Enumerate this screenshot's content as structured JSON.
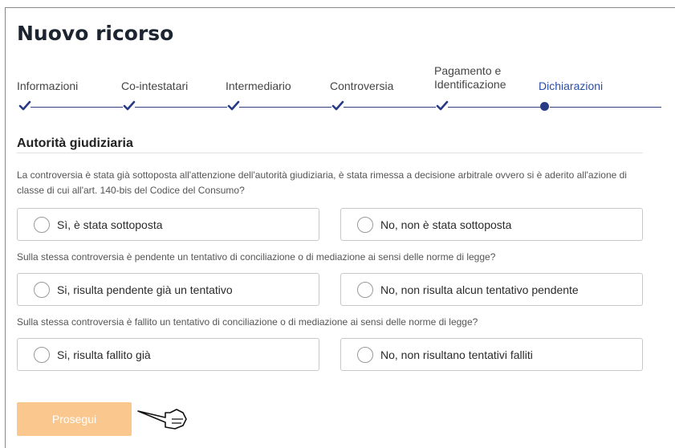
{
  "page_title": "Nuovo ricorso",
  "steps": [
    {
      "label": "Informazioni",
      "state": "done"
    },
    {
      "label": "Co-intestatari",
      "state": "done"
    },
    {
      "label": "Intermediario",
      "state": "done"
    },
    {
      "label": "Controversia",
      "state": "done"
    },
    {
      "label_line1": "Pagamento e",
      "label_line2": "Identificazione",
      "state": "done"
    },
    {
      "label": "Dichiarazioni",
      "state": "active"
    }
  ],
  "section": {
    "title": "Autorità giudiziaria",
    "questions": [
      {
        "text": "La controversia è stata già sottoposta all'attenzione dell'autorità giudiziaria, è stata rimessa a decisione arbitrale ovvero si è aderito all'azione di classe di cui all'art. 140-bis del Codice del Consumo?",
        "yes": "Sì, è stata sottoposta",
        "no": "No, non è stata sottoposta"
      },
      {
        "text": "Sulla stessa controversia è pendente un tentativo di conciliazione o di mediazione ai sensi delle norme di legge?",
        "yes": "Si, risulta pendente già un tentativo",
        "no": "No, non risulta alcun tentativo pendente"
      },
      {
        "text": "Sulla stessa controversia è fallito un tentativo di conciliazione o di mediazione ai sensi delle norme di legge?",
        "yes": "Si, risulta fallito già",
        "no": "No, non risultano tentativi falliti"
      }
    ]
  },
  "actions": {
    "proceed_label": "Prosegui"
  },
  "colors": {
    "accent": "#273a86",
    "button": "#fac88e",
    "active_step": "#2b4ea2"
  }
}
